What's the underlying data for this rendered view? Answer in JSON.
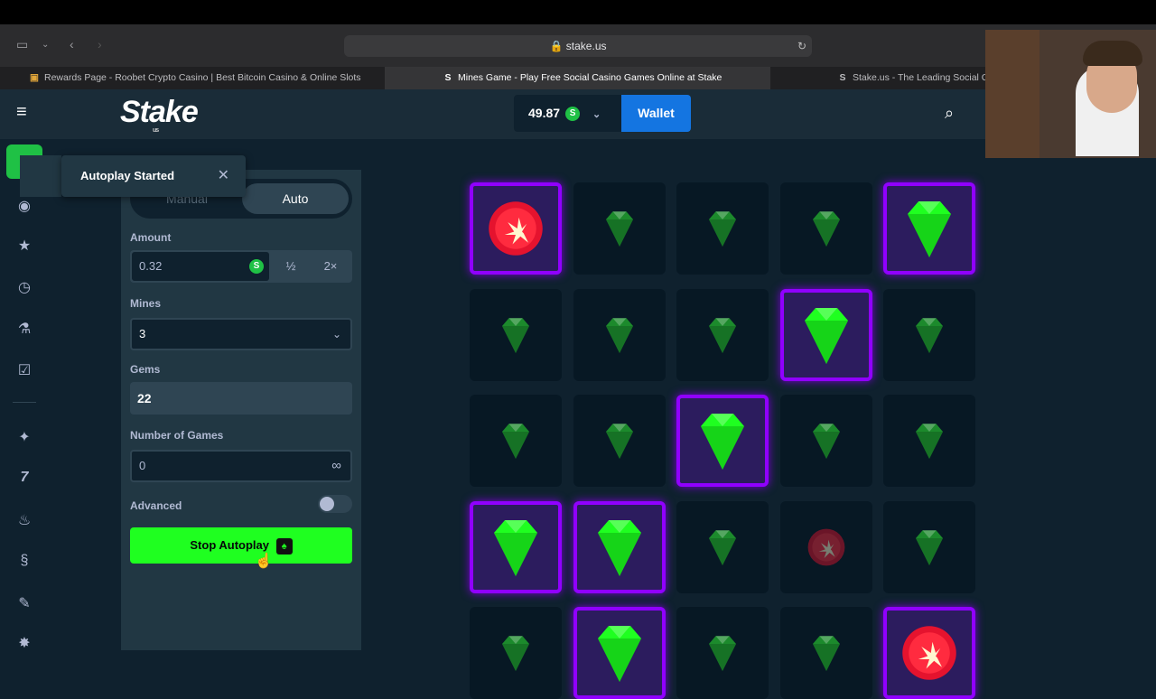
{
  "browser": {
    "url": "stake.us",
    "tabs": [
      {
        "label": "Rewards Page - Roobet Crypto Casino | Best Bitcoin Casino & Online Slots",
        "active": false
      },
      {
        "label": "Mines Game - Play Free Social Casino Games Online at Stake",
        "active": true
      },
      {
        "label": "Stake.us - The Leading Social C",
        "active": false
      }
    ]
  },
  "header": {
    "logo": "Stake",
    "logo_sub": "us",
    "balance": "49.87",
    "currency_symbol": "S",
    "wallet_label": "Wallet"
  },
  "toast": {
    "message": "Autoplay Started"
  },
  "panel": {
    "mode_manual": "Manual",
    "mode_auto": "Auto",
    "amount_label": "Amount",
    "amount_value": "0.32",
    "half_label": "½",
    "double_label": "2×",
    "mines_label": "Mines",
    "mines_value": "3",
    "gems_label": "Gems",
    "gems_value": "22",
    "games_label": "Number of Games",
    "games_value": "0",
    "infinity": "∞",
    "advanced_label": "Advanced",
    "stop_label": "Stop Autoplay"
  },
  "colors": {
    "accent_green": "#1fff20",
    "wallet_blue": "#1475e1",
    "select_purple": "#9000ff",
    "mine_red": "#e5132e",
    "bg": "#0f212e"
  },
  "grid": {
    "rows": [
      [
        "mine-selected",
        "gem",
        "gem",
        "gem",
        "gem-selected"
      ],
      [
        "gem",
        "gem",
        "gem",
        "gem-selected",
        "gem"
      ],
      [
        "gem",
        "gem",
        "gem-selected",
        "gem",
        "gem"
      ],
      [
        "gem-selected",
        "gem-selected",
        "gem",
        "mine",
        "gem"
      ],
      [
        "gem",
        "gem-selected",
        "gem",
        "gem",
        "mine-selected"
      ]
    ]
  }
}
